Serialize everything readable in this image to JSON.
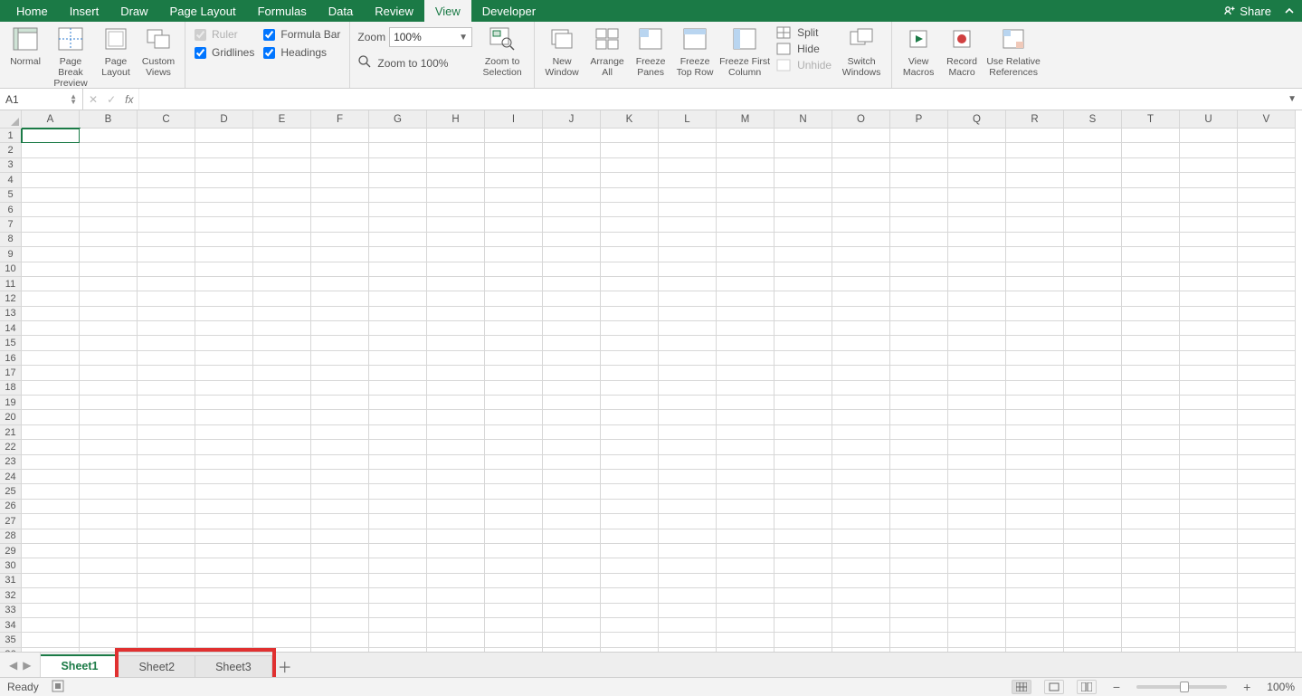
{
  "menu": {
    "items": [
      "Home",
      "Insert",
      "Draw",
      "Page Layout",
      "Formulas",
      "Data",
      "Review",
      "View",
      "Developer"
    ],
    "active_index": 7,
    "share_label": "Share"
  },
  "ribbon": {
    "views": {
      "normal": "Normal",
      "page_break": "Page Break Preview",
      "page_layout": "Page Layout",
      "custom": "Custom Views"
    },
    "show": {
      "ruler": {
        "label": "Ruler",
        "checked": true,
        "disabled": true
      },
      "formula_bar": {
        "label": "Formula Bar",
        "checked": true,
        "disabled": false
      },
      "gridlines": {
        "label": "Gridlines",
        "checked": true,
        "disabled": false
      },
      "headings": {
        "label": "Headings",
        "checked": true,
        "disabled": false
      }
    },
    "zoom": {
      "label": "Zoom",
      "value": "100%",
      "to100": "Zoom to 100%",
      "to_selection": "Zoom to Selection"
    },
    "window": {
      "new": "New Window",
      "arrange": "Arrange All",
      "freeze_panes": "Freeze Panes",
      "freeze_top": "Freeze Top Row",
      "freeze_first": "Freeze First Column",
      "split": "Split",
      "hide": "Hide",
      "unhide": "Unhide",
      "switch": "Switch Windows"
    },
    "macros": {
      "view": "View Macros",
      "record": "Record Macro",
      "relative": "Use Relative References"
    }
  },
  "formula_bar": {
    "cell_ref": "A1",
    "fx": "fx",
    "value": ""
  },
  "grid": {
    "columns": [
      "A",
      "B",
      "C",
      "D",
      "E",
      "F",
      "G",
      "H",
      "I",
      "J",
      "K",
      "L",
      "M",
      "N",
      "O",
      "P",
      "Q",
      "R",
      "S",
      "T",
      "U",
      "V"
    ],
    "row_count": 36,
    "selected_cell": "A1"
  },
  "tabs": {
    "sheets": [
      "Sheet1",
      "Sheet2",
      "Sheet3"
    ],
    "active_index": 0
  },
  "highlight": {
    "tab_start_index": 1,
    "tab_end_index": 2
  },
  "status": {
    "ready": "Ready",
    "zoom": "100%"
  }
}
